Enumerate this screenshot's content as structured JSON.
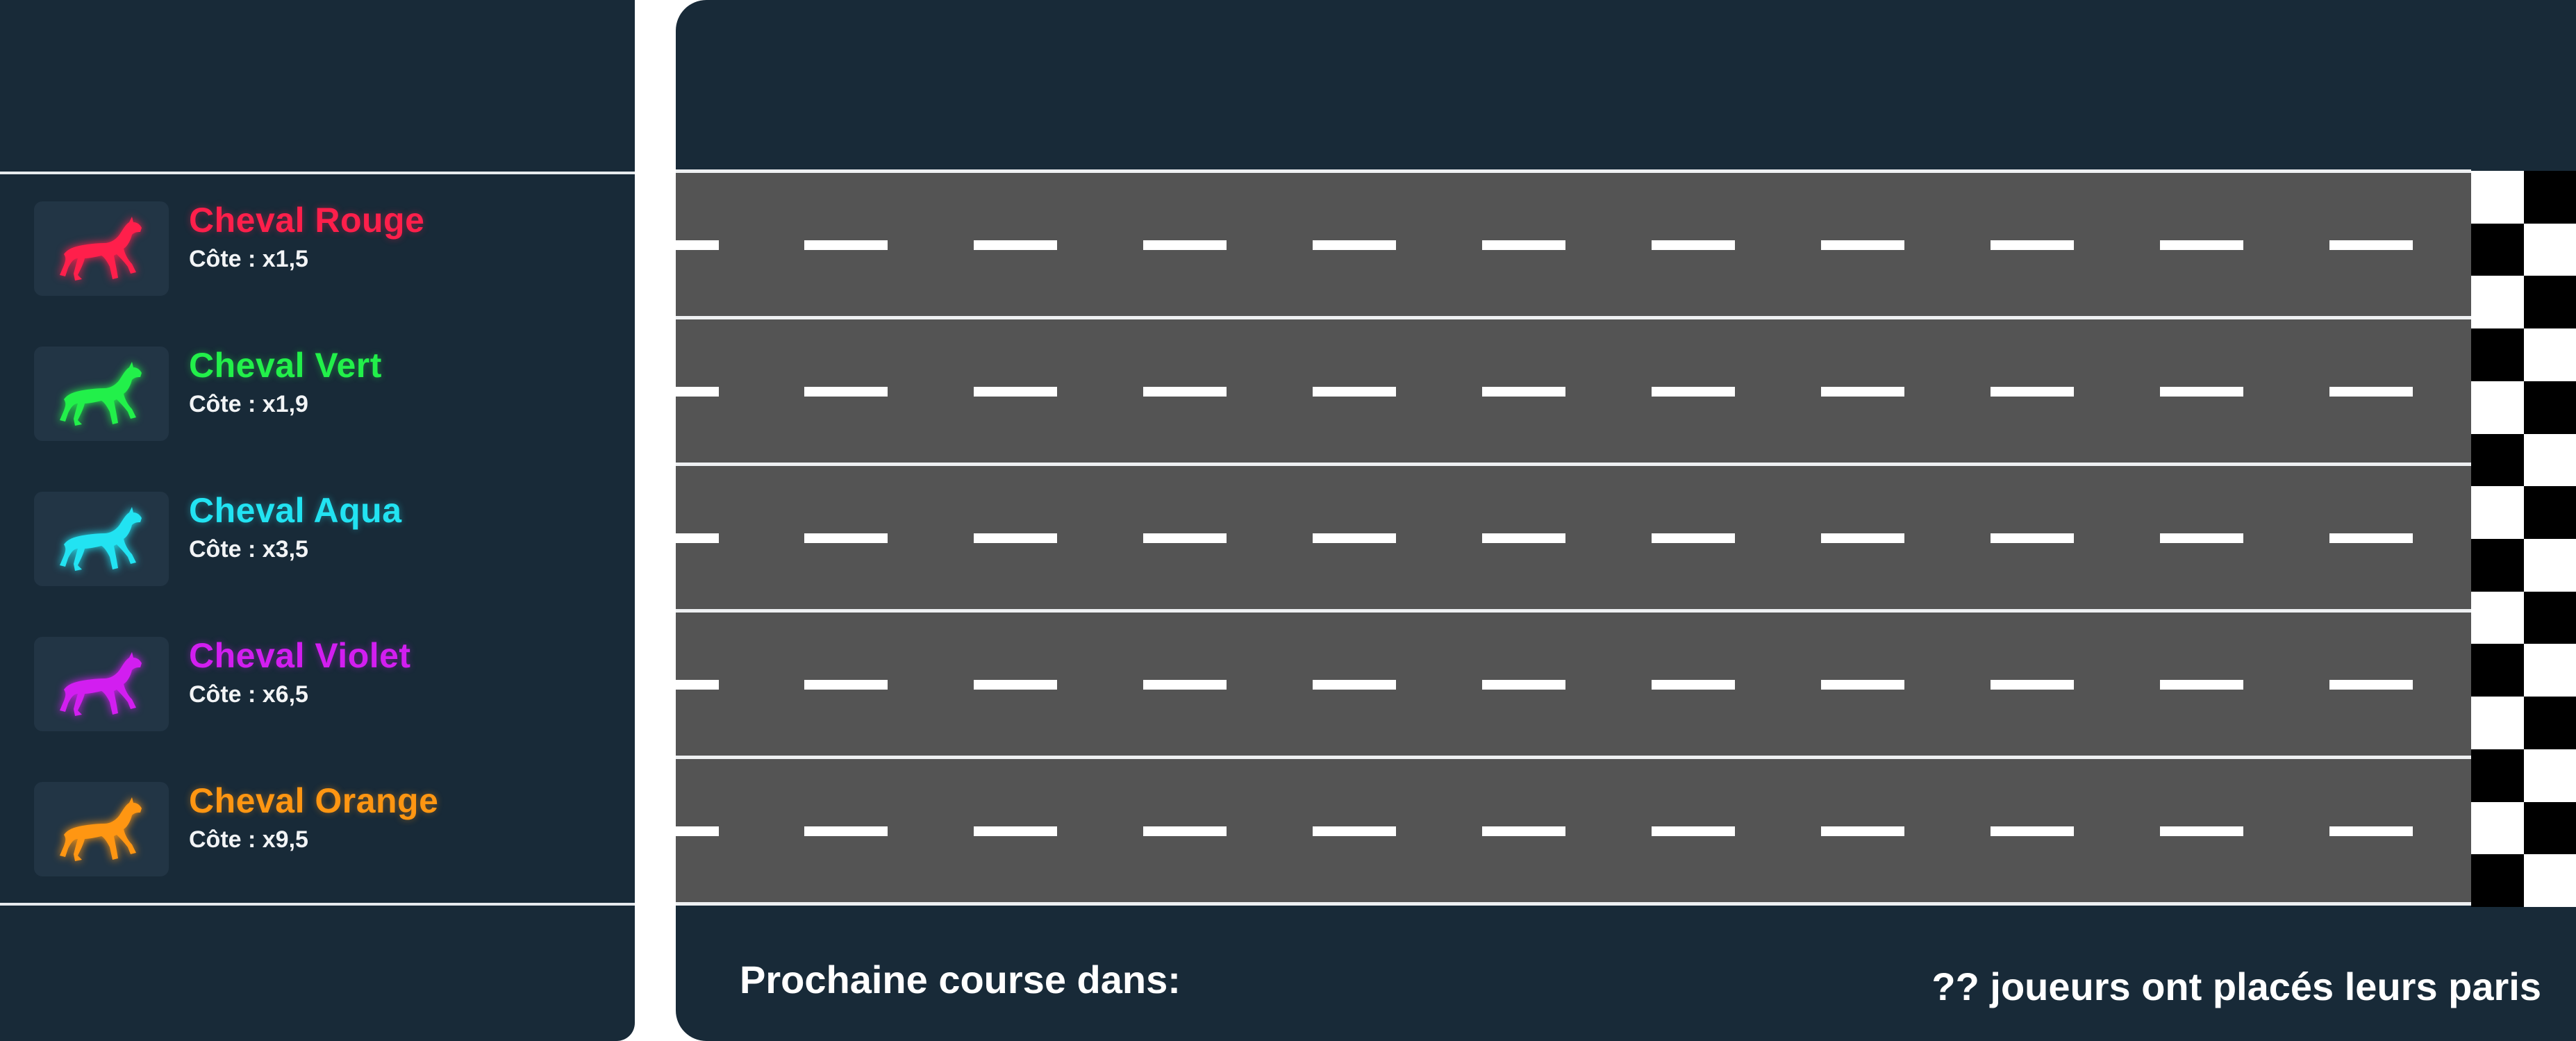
{
  "horses": [
    {
      "name": "Cheval Rouge",
      "odds": "Côte : x1,5",
      "color": "#ff1f4b",
      "icon": "horse-icon"
    },
    {
      "name": "Cheval Vert",
      "odds": "Côte : x1,9",
      "color": "#22f04a",
      "icon": "horse-icon"
    },
    {
      "name": "Cheval Aqua",
      "odds": "Côte : x3,5",
      "color": "#22e3f2",
      "icon": "horse-icon"
    },
    {
      "name": "Cheval Violet",
      "odds": "Côte : x6,5",
      "color": "#d21ef0",
      "icon": "horse-icon"
    },
    {
      "name": "Cheval Orange",
      "odds": "Côte : x9,5",
      "color": "#ff9612",
      "icon": "horse-icon"
    }
  ],
  "race": {
    "lane_count": 5,
    "finish_line": "checkered-flag"
  },
  "footer": {
    "next_race_label": "Prochaine course dans:",
    "players_bet_text": "?? joueurs ont placés leurs paris"
  },
  "colors": {
    "panel_bg": "#182a38",
    "track": "#545454",
    "lane_line": "#eef0f2"
  }
}
